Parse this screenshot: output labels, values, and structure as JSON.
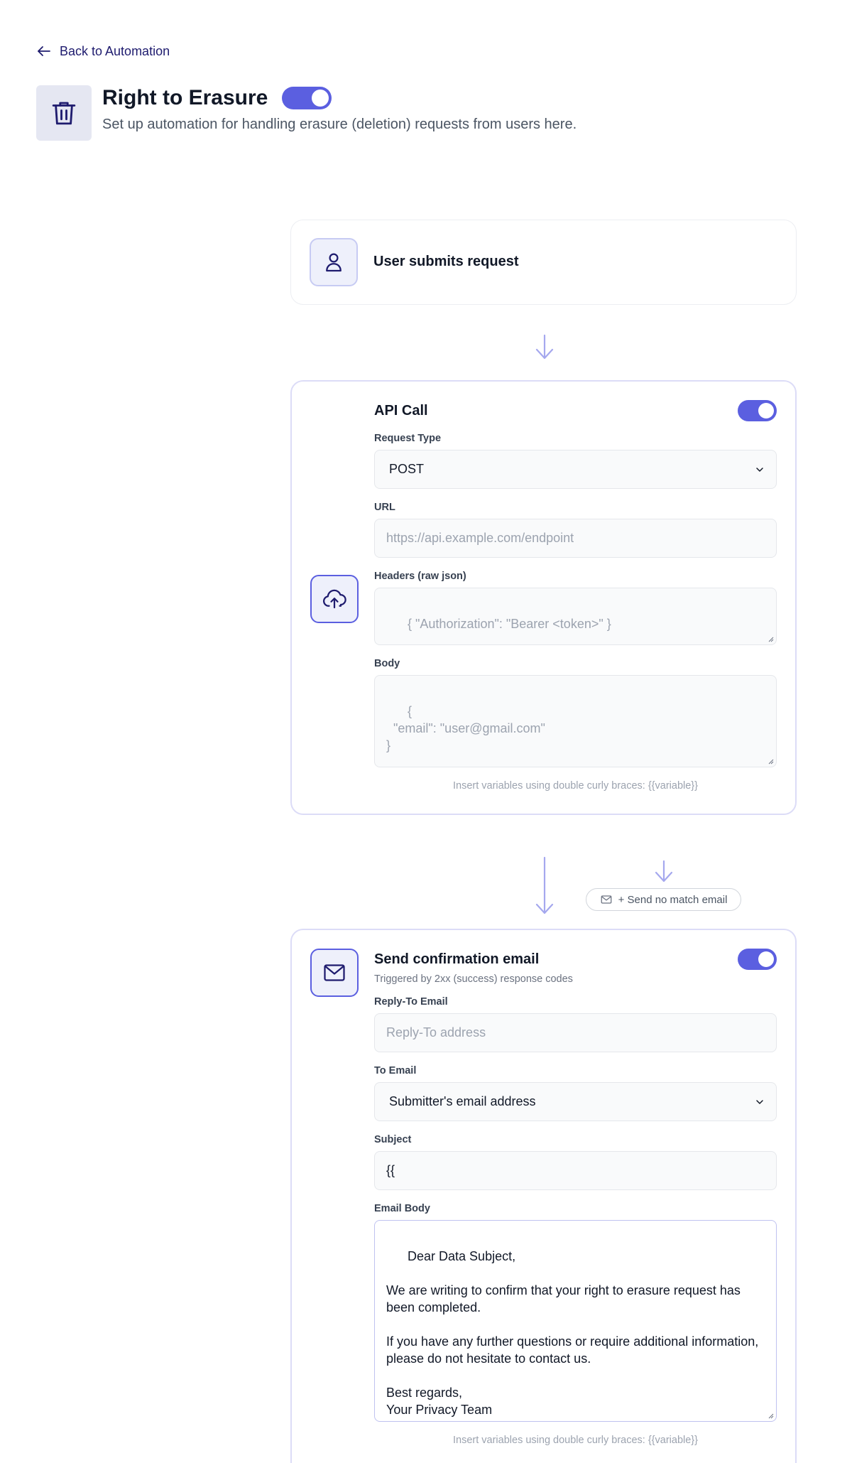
{
  "nav": {
    "back_label": "Back to Automation"
  },
  "header": {
    "title": "Right to Erasure",
    "subtitle": "Set up automation for handling erasure (deletion) requests from users here.",
    "enabled": true
  },
  "steps": {
    "trigger": {
      "title": "User submits request"
    },
    "api_call": {
      "title": "API Call",
      "enabled": true,
      "request_type_label": "Request Type",
      "request_type_value": "POST",
      "url_label": "URL",
      "url_placeholder": "https://api.example.com/endpoint",
      "headers_label": "Headers (raw json)",
      "headers_placeholder": "{ \"Authorization\": \"Bearer <token>\" }",
      "body_label": "Body",
      "body_placeholder": "{\n  \"email\": \"user@gmail.com\"\n}",
      "hint": "Insert variables using double curly braces: {{variable}}"
    },
    "no_match": {
      "label": "+ Send no match email"
    },
    "confirmation_email": {
      "title": "Send confirmation email",
      "subtitle": "Triggered by 2xx (success) response codes",
      "enabled": true,
      "reply_to_label": "Reply-To Email",
      "reply_to_placeholder": "Reply-To address",
      "to_label": "To Email",
      "to_value": "Submitter's email address",
      "subject_label": "Subject",
      "subject_value": "{{",
      "body_label": "Email Body",
      "body_value": "Dear Data Subject,\n\nWe are writing to confirm that your right to erasure request has been completed.\n\nIf you have any further questions or require additional information, please do not hesitate to contact us.\n\nBest regards,\nYour Privacy Team",
      "hint": "Insert variables using double curly braces: {{variable}}"
    }
  },
  "colors": {
    "accent": "#5b5fe0",
    "accent_light": "#a5a8ee",
    "navy": "#1e1b6e"
  },
  "icons": {
    "back": "arrow-left-icon",
    "header": "trash-icon",
    "trigger": "user-icon",
    "api_call": "cloud-upload-icon",
    "email": "mail-icon",
    "select": "chevron-down-icon"
  }
}
